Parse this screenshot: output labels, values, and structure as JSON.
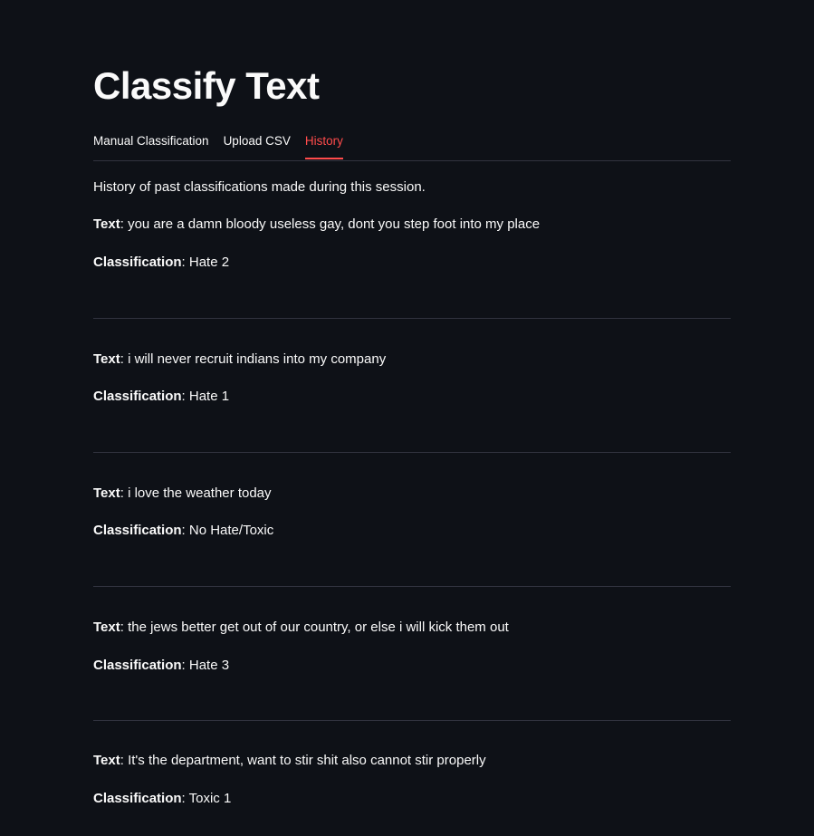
{
  "page": {
    "title": "Classify Text",
    "intro": "History of past classifications made during this session."
  },
  "tabs": [
    {
      "label": "Manual Classification",
      "active": false
    },
    {
      "label": "Upload CSV",
      "active": false
    },
    {
      "label": "History",
      "active": true
    }
  ],
  "labels": {
    "text": "Text",
    "classification": "Classification",
    "separator": ":"
  },
  "history": [
    {
      "text": "you are a damn bloody useless gay, dont you step foot into my place",
      "classification": "Hate 2"
    },
    {
      "text": "i will never recruit indians into my company",
      "classification": "Hate 1"
    },
    {
      "text": "i love the weather today",
      "classification": "No Hate/Toxic"
    },
    {
      "text": "the jews better get out of our country, or else i will kick them out",
      "classification": "Hate 3"
    },
    {
      "text": "It's the department, want to stir shit also cannot stir properly",
      "classification": "Toxic 1"
    }
  ],
  "colors": {
    "background": "#0e1117",
    "text": "#fafafa",
    "accent": "#ff4b4b",
    "divider": "#31333f"
  }
}
